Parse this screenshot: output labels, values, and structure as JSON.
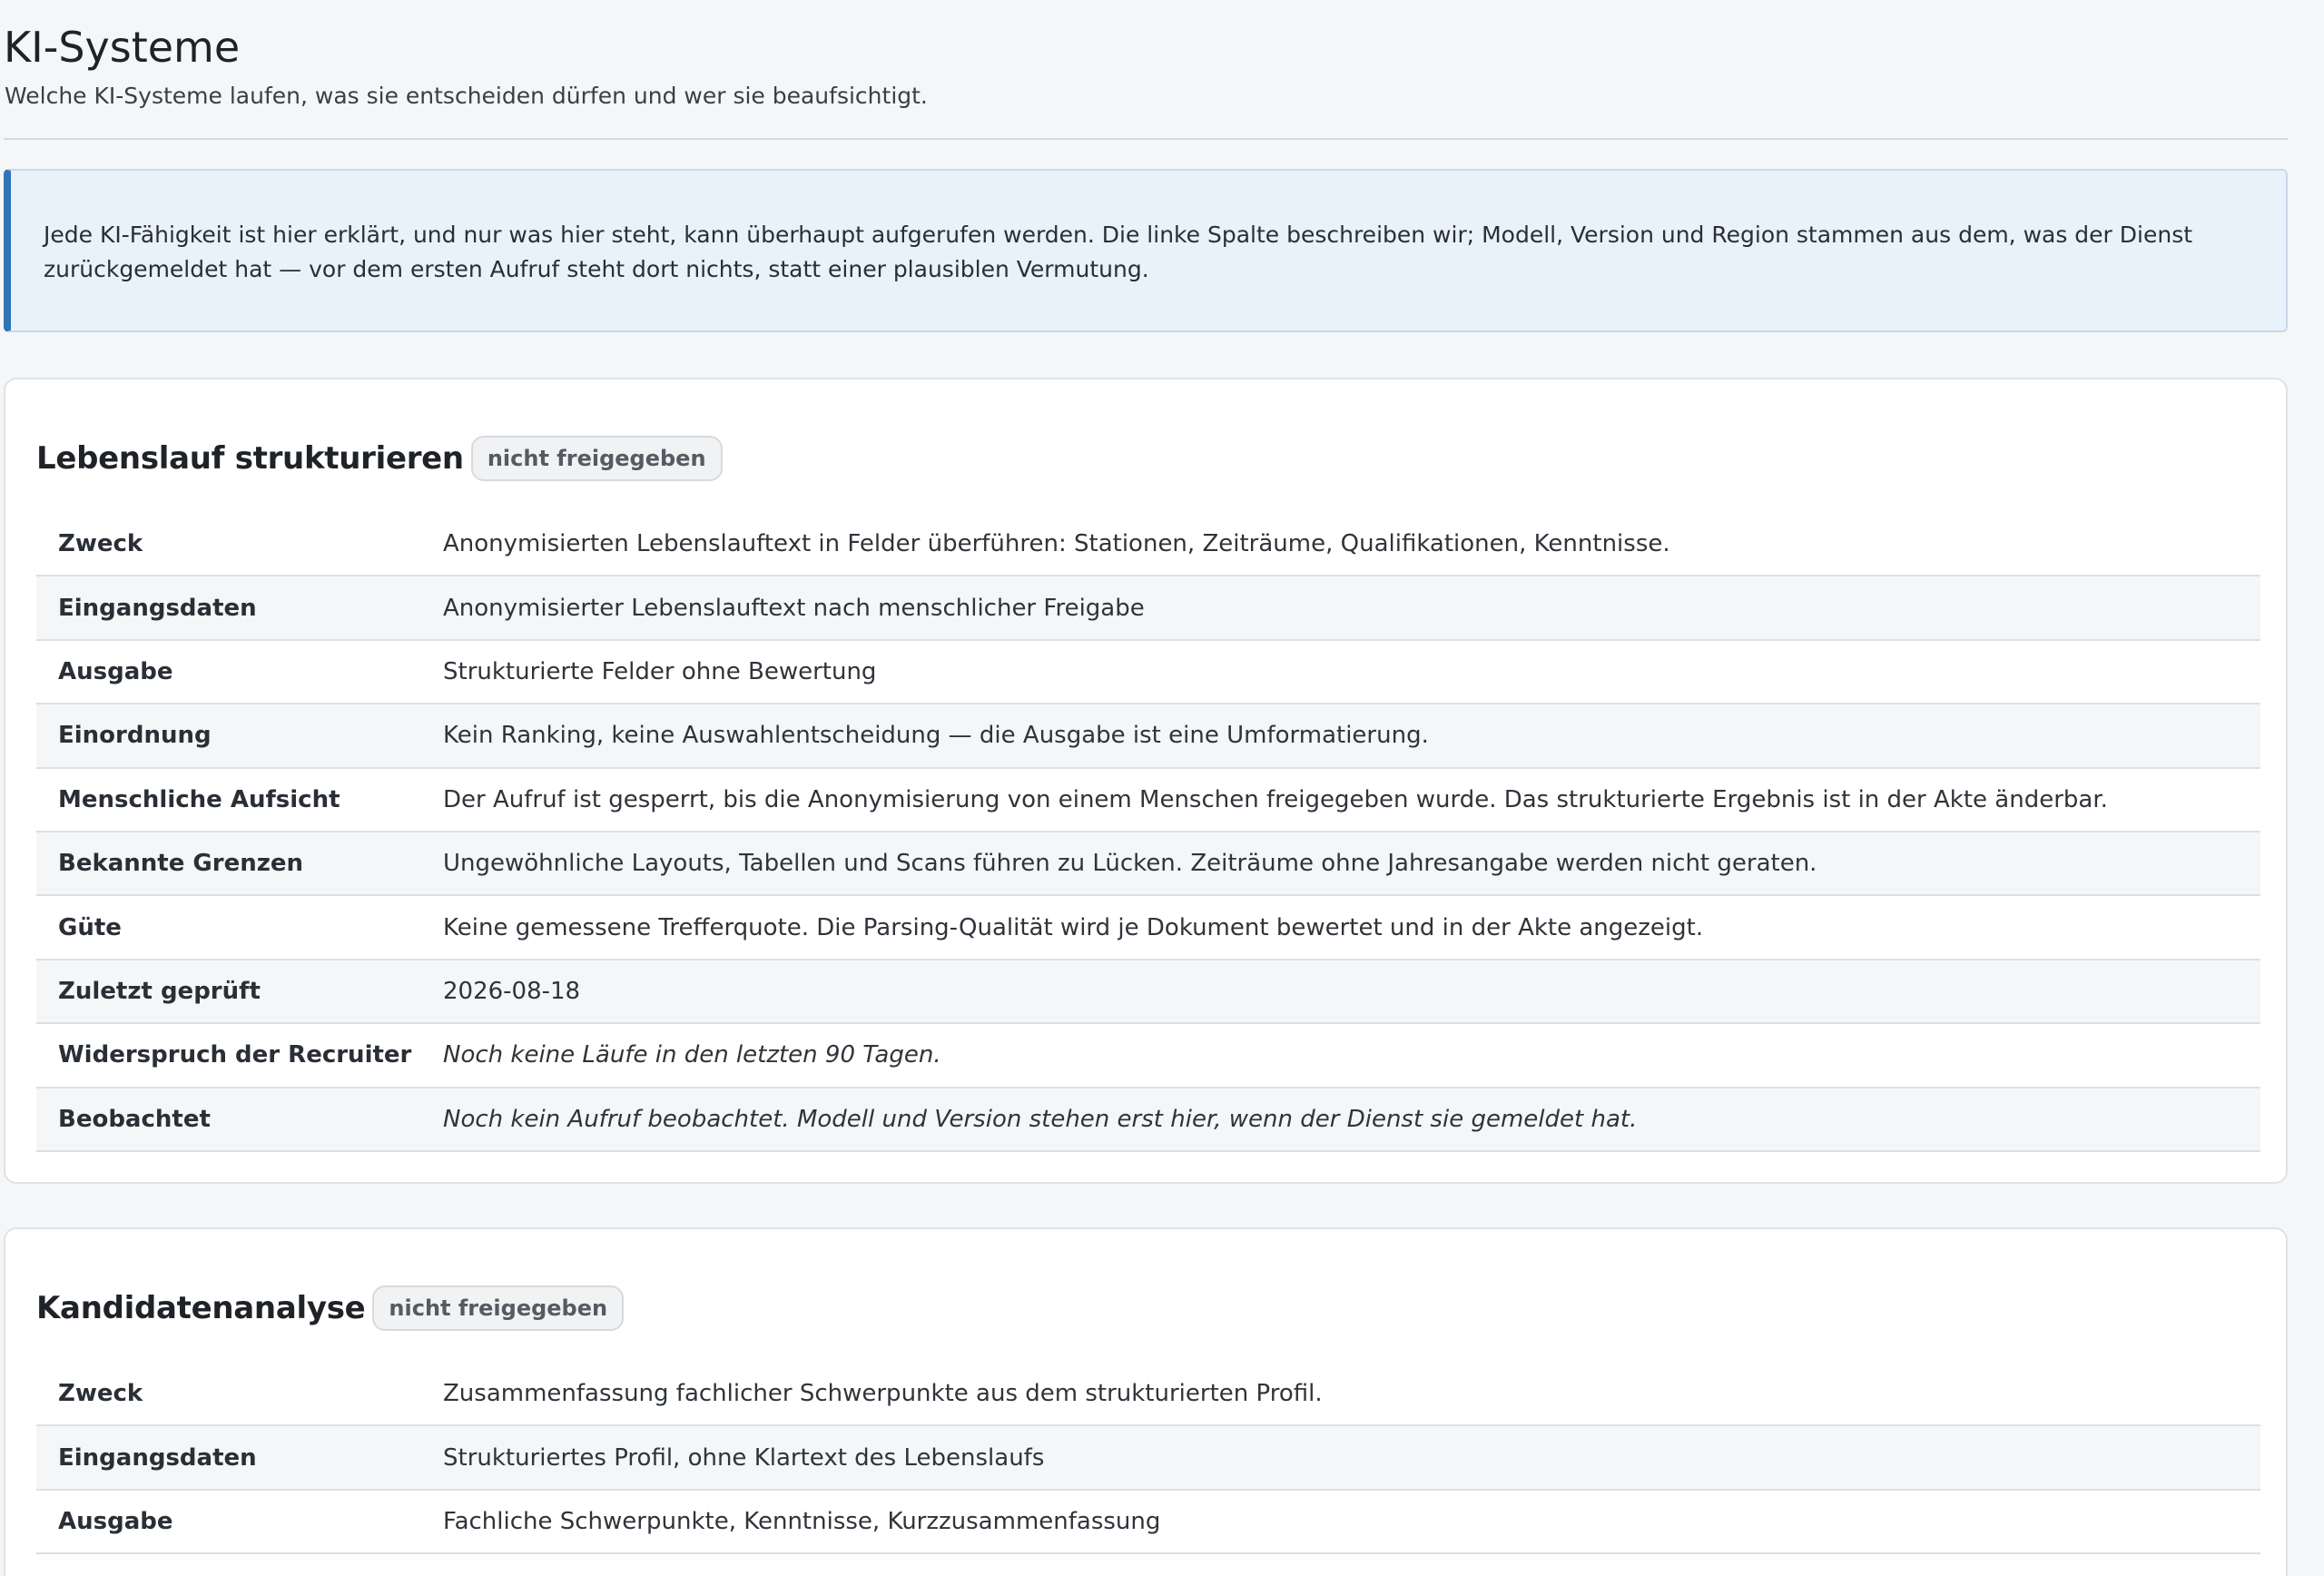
{
  "header": {
    "title": "KI-Systeme",
    "subtitle": "Welche KI-Systeme laufen, was sie entscheiden dürfen und wer sie beaufsichtigt."
  },
  "notice": {
    "text": "Jede KI-Fähigkeit ist hier erklärt, und nur was hier steht, kann überhaupt aufgerufen werden. Die linke Spalte beschreiben wir; Modell, Version und Region stammen aus dem, was der Dienst zurückgemeldet hat — vor dem ersten Aufruf steht dort nichts, statt einer plausiblen Vermutung."
  },
  "systems": [
    {
      "title": "Lebenslauf strukturieren",
      "status": "nicht freigegeben",
      "rows": [
        {
          "key": "Zweck",
          "value": "Anonymisierten Lebenslauftext in Felder überführen: Stationen, Zeiträume, Qualifikationen, Kenntnisse."
        },
        {
          "key": "Eingangsdaten",
          "value": "Anonymisierter Lebenslauftext nach menschlicher Freigabe"
        },
        {
          "key": "Ausgabe",
          "value": "Strukturierte Felder ohne Bewertung"
        },
        {
          "key": "Einordnung",
          "value": "Kein Ranking, keine Auswahlentscheidung — die Ausgabe ist eine Umformatierung."
        },
        {
          "key": "Menschliche Aufsicht",
          "value": "Der Aufruf ist gesperrt, bis die Anonymisierung von einem Menschen freigegeben wurde. Das strukturierte Ergebnis ist in der Akte änderbar."
        },
        {
          "key": "Bekannte Grenzen",
          "value": "Ungewöhnliche Layouts, Tabellen und Scans führen zu Lücken. Zeiträume ohne Jahresangabe werden nicht geraten."
        },
        {
          "key": "Güte",
          "value": "Keine gemessene Trefferquote. Die Parsing-Qualität wird je Dokument bewertet und in der Akte angezeigt."
        },
        {
          "key": "Zuletzt geprüft",
          "value": "2026-08-18"
        },
        {
          "key": "Widerspruch der Recruiter",
          "value": "Noch keine Läufe in den letzten 90 Tagen."
        },
        {
          "key": "Beobachtet",
          "value": "Noch kein Aufruf beobachtet. Modell und Version stehen erst hier, wenn der Dienst sie gemeldet hat."
        }
      ]
    },
    {
      "title": "Kandidatenanalyse",
      "status": "nicht freigegeben",
      "rows": [
        {
          "key": "Zweck",
          "value": "Zusammenfassung fachlicher Schwerpunkte aus dem strukturierten Profil."
        },
        {
          "key": "Eingangsdaten",
          "value": "Strukturiertes Profil, ohne Klartext des Lebenslaufs"
        },
        {
          "key": "Ausgabe",
          "value": "Fachliche Schwerpunkte, Kenntnisse, Kurzzusammenfassung"
        }
      ]
    }
  ]
}
